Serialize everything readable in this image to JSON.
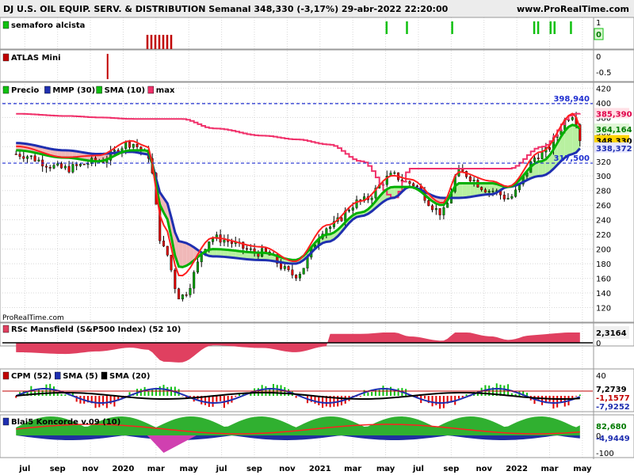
{
  "header": {
    "title": "DJ U.S. OIL EQUIP. SERV. & DISTRIBUTION Semanal 348,330 (-3,17%) 29-abr-2022 22:20:00",
    "site": "www.ProRealTime.com",
    "watermark": "ProRealTime.com"
  },
  "colors": {
    "price_up": "#00a000",
    "price_down": "#e00000",
    "mmp30": "#1f2fb0",
    "sma10": "#00b000",
    "max_line": "#f0306a",
    "sma_red": "#ff2020",
    "level_line": "#1f2fd0",
    "grid": "#d8d8d8"
  },
  "panels": {
    "semaforo": {
      "legend": "semaforo alcista",
      "tick_labels": [
        "1",
        "0"
      ],
      "badge": "0"
    },
    "atlas": {
      "legend": "ATLAS Mini",
      "tick_labels": [
        "0",
        "-0.5"
      ]
    },
    "precio": {
      "legend": [
        "Precio",
        "MMP (30)",
        "SMA (10)",
        "max"
      ],
      "badges": {
        "max": "385,390",
        "sma10": "364,164",
        "last": "348,330",
        "mmp30": "338,372"
      },
      "levels": {
        "upper": "398,940",
        "lower": "317,500"
      }
    },
    "rsc": {
      "legend": "RSc Mansfield (S&P500 Index) (52 10)",
      "badge": "2,3164",
      "tick_labels": [
        "0"
      ]
    },
    "cpm": {
      "legend": [
        "CPM (52)",
        "SMA (5)",
        "SMA (20)"
      ],
      "badges": [
        "7,2739",
        "-1,1577",
        "-7,9252"
      ],
      "tick_labels": [
        "40",
        "0"
      ]
    },
    "koncorde": {
      "legend": "Blai5 Koncorde v.09 (10)",
      "badges": [
        "82,680",
        "-4,9449"
      ],
      "tick_labels": [
        "0",
        "-100"
      ]
    }
  },
  "chart_data": {
    "type": "line",
    "title": "DJ U.S. OIL EQUIP. SERV. & DISTRIBUTION Semanal",
    "x_tick_labels": [
      "jul",
      "sep",
      "nov",
      "2020",
      "mar",
      "may",
      "jul",
      "sep",
      "nov",
      "2021",
      "mar",
      "may",
      "jul",
      "sep",
      "nov",
      "2022",
      "mar",
      "may"
    ],
    "y_ticks": [
      120,
      140,
      160,
      180,
      200,
      220,
      240,
      260,
      280,
      300,
      320,
      340,
      360,
      380,
      400,
      420
    ],
    "ylim": [
      100,
      428
    ],
    "grid": true,
    "levels": [
      398.94,
      317.5
    ],
    "anchors": {
      "x": [
        "2019-06",
        "2019-09",
        "2019-11",
        "2020-01",
        "2020-02",
        "2020-03",
        "2020-04",
        "2020-06",
        "2020-09",
        "2020-11",
        "2021-01",
        "2021-03",
        "2021-05",
        "2021-06",
        "2021-08",
        "2021-09",
        "2021-11",
        "2021-12",
        "2022-02",
        "2022-04",
        "2022-04-29"
      ],
      "price": [
        330,
        310,
        320,
        345,
        330,
        200,
        135,
        215,
        195,
        165,
        230,
        265,
        300,
        290,
        250,
        305,
        280,
        270,
        330,
        385,
        348.33
      ],
      "mmp30": [
        345,
        335,
        330,
        333,
        330,
        270,
        210,
        190,
        185,
        180,
        210,
        245,
        270,
        285,
        270,
        270,
        275,
        285,
        300,
        330,
        338.37
      ],
      "sma10": [
        335,
        325,
        320,
        335,
        335,
        250,
        175,
        200,
        195,
        185,
        220,
        250,
        285,
        285,
        260,
        290,
        290,
        285,
        320,
        370,
        364.16
      ],
      "max": [
        385,
        382,
        380,
        378,
        378,
        378,
        378,
        365,
        355,
        350,
        343,
        320,
        270,
        310,
        310,
        310,
        310,
        310,
        340,
        385,
        385.39
      ]
    },
    "semaforo_signals": [
      "2021-05",
      "2021-06",
      "2021-09",
      "2022-02",
      "2022-02",
      "2022-03",
      "2022-03",
      "2022-04"
    ],
    "atlas_signals": [
      "2019-12"
    ],
    "rsc_range": [
      -30,
      15
    ],
    "cpm_range": [
      -60,
      60
    ],
    "koncorde_range": [
      -120,
      120
    ]
  }
}
